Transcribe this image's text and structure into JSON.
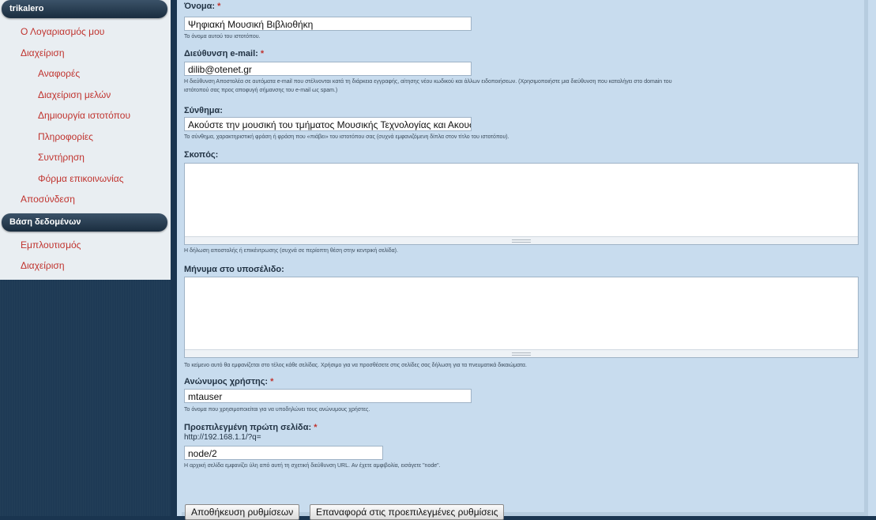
{
  "sidebar": {
    "user_block_title": "trikalero",
    "user_menu": [
      {
        "label": "Ο Λογαριασμός μου",
        "level": 1
      },
      {
        "label": "Διαχείριση",
        "level": 1
      },
      {
        "label": "Αναφορές",
        "level": 2
      },
      {
        "label": "Διαχείριση μελών",
        "level": 2
      },
      {
        "label": "Δημιουργία ιστοτόπου",
        "level": 2
      },
      {
        "label": "Πληροφορίες",
        "level": 2,
        "active": true
      },
      {
        "label": "Συντήρηση",
        "level": 2
      },
      {
        "label": "Φόρμα επικοινωνίας",
        "level": 2
      },
      {
        "label": "Αποσύνδεση",
        "level": 1
      }
    ],
    "db_block_title": "Βάση δεδομένων",
    "db_menu": [
      {
        "label": "Εμπλουτισμός",
        "level": 1
      },
      {
        "label": "Διαχείριση",
        "level": 1
      }
    ]
  },
  "form": {
    "name": {
      "label": "Όνομα:",
      "value": "Ψηφιακή Μουσική Βιβλιοθήκη",
      "description": "Το όνομα αυτού του ιστοτόπου."
    },
    "email": {
      "label": "Διεύθυνση e-mail:",
      "value": "dilib@otenet.gr",
      "description_1": "Η διεύθυνση Αποστολέα σε αυτόματα e-mail που στέλνονται κατά τη διάρκεια εγγραφής, αίτησης νέου κωδικού και άλλων ειδοποιήσεων. (Χρησιμοποιήστε μια διεύθυνση που καταλήγει στο domain του",
      "description_2": "ιστότοπού σας προς αποφυγή σήμανσης του e-mail ως spam.)"
    },
    "slogan": {
      "label": "Σύνθημα:",
      "value": "Ακούστε την μουσική του τμήματος Μουσικής Τεχνολογίας και Ακουστικής",
      "description": "Το σύνθημα, χαρακτηριστική φράση ή φράση που «πιάβει» του ιστοτόπου σας (συχνά εμφανιζόμενη δίπλα στον τίτλο του ιστοτόπου)."
    },
    "mission": {
      "label": "Σκοπός:",
      "value": "",
      "description": "Η δήλωση αποστολής ή επικέντρωσης (συχνά σε περίοπτη θέση στην κεντρική σελίδα)."
    },
    "footer": {
      "label": "Μήνυμα στο υποσέλιδο:",
      "value": "",
      "description": "Το κείμενο αυτό θα εμφανίζεται στο τέλος κάθε σελίδας. Χρήσιμο για να προσθέσετε στις σελίδες σας δήλωση για τα πνευματικά δικαιώματα."
    },
    "anonymous": {
      "label": "Ανώνυμος χρήστης:",
      "value": "mtauser",
      "description": "Το όνομα που χρησιμοποιείται για να υποδηλώνει τους ανώνυμους χρήστες."
    },
    "front_page": {
      "label": "Προεπιλεγμένη πρώτη σελίδα:",
      "prefix": "http://192.168.1.1/?q=",
      "value": "node/2",
      "description": "Η αρχική σελίδα εμφανίζει ύλη από αυτή τη σχετική διεύθυνση URL. Αν έχετε αμφιβολία, εισάγετε \"node\"."
    },
    "required_marker": "*",
    "save_button": "Αποθήκευση ρυθμίσεων",
    "reset_button": "Επαναφορά στις προεπιλεγμένες ρυθμίσεις"
  }
}
